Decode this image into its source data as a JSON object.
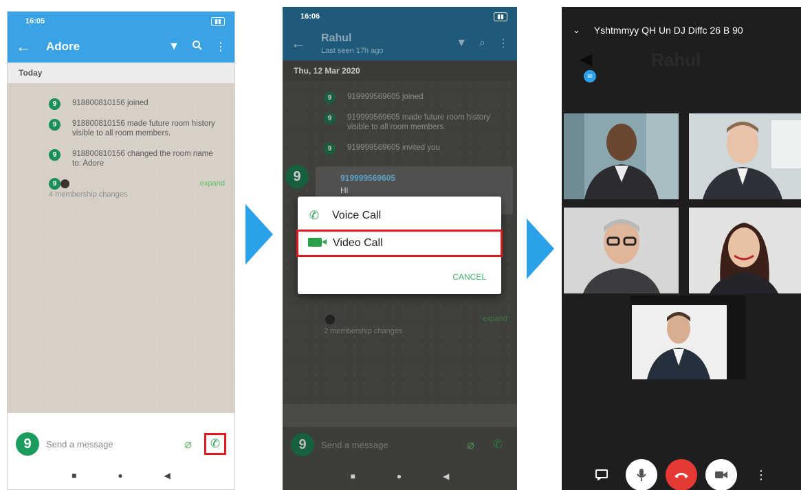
{
  "screen1": {
    "status_time": "16:05",
    "status_icons": "signal-battery",
    "room_title": "Adore",
    "date_header": "Today",
    "events": [
      {
        "avatar": "9",
        "text": "918800810156 joined"
      },
      {
        "avatar": "9",
        "text": "918800810156 made future room history visible to all room members."
      },
      {
        "avatar": "9",
        "text": "918800810156 changed the room name to: Adore"
      }
    ],
    "expand_label": "expand",
    "membership_changes": "4 membership changes",
    "composer_avatar": "9",
    "composer_placeholder": "Send a message"
  },
  "screen2": {
    "status_time": "16:06",
    "room_title": "Rahul",
    "room_subtitle": "Last seen 17h ago",
    "date_header": "Thu, 12 Mar 2020",
    "events": [
      {
        "avatar": "9",
        "text": "919999569605 joined"
      },
      {
        "avatar": "9",
        "text": "919999569605 made future room history visible to all room members."
      },
      {
        "avatar": "9",
        "text": "919999569605 invited you"
      }
    ],
    "message": {
      "avatar": "9",
      "sender": "919999569605",
      "text": "Hi"
    },
    "expand_label": "expand",
    "membership_changes": "2 membership changes",
    "dialog": {
      "voice_call": "Voice Call",
      "video_call": "Video Call",
      "cancel": "CANCEL"
    },
    "composer_avatar": "9",
    "composer_placeholder": "Send a message"
  },
  "screen3": {
    "call_title": "Yshtmmyy QH Un DJ Diffc 26 B 90",
    "background_name": "Rahul",
    "participants": [
      {
        "name": "participant-1",
        "bg": "#8aa7b0",
        "skin": "#6b4630",
        "suit": "#2b2b30"
      },
      {
        "name": "participant-2",
        "bg": "#cfd7db",
        "skin": "#e8c3a8",
        "suit": "#2e3138"
      },
      {
        "name": "participant-3",
        "bg": "#d6d6d4",
        "skin": "#e0b69a",
        "suit": "#3b3b40"
      },
      {
        "name": "participant-4",
        "bg": "#e2e2e0",
        "skin": "#e9c1a3",
        "suit": "#24242a"
      },
      {
        "name": "participant-5",
        "bg": "#efefef",
        "skin": "#d9ad8f",
        "suit": "#26303c"
      }
    ],
    "colors": {
      "hangup": "#e53935",
      "control_bg": "#ffffff"
    }
  },
  "colors": {
    "accent": "#3aa3e5",
    "green": "#1b8f5a",
    "highlight": "#e0191e",
    "arrow": "#2aa1e8"
  }
}
